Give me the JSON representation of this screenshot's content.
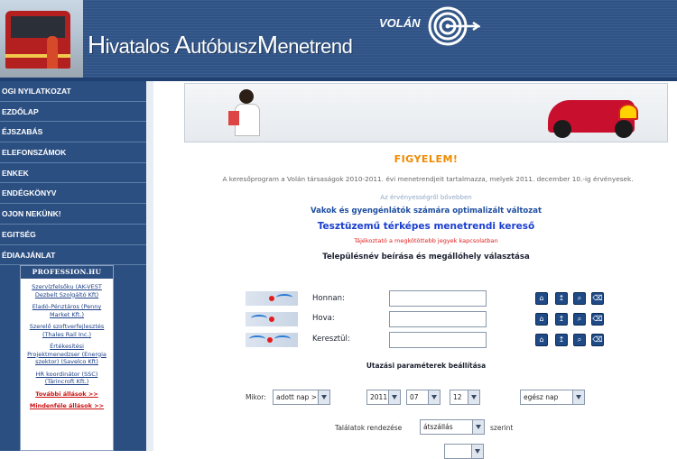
{
  "header": {
    "title_parts": [
      {
        "cap": "H",
        "rest": "ivatalos "
      },
      {
        "cap": "A",
        "rest": "utóbusz"
      },
      {
        "cap": "M",
        "rest": "enetrend"
      }
    ],
    "logo_text": "VOLÁN"
  },
  "sidebar": {
    "items": [
      {
        "label": "OGI NYILATKOZAT"
      },
      {
        "label": "EZDŐLAP"
      },
      {
        "label": "ÉJSZABÁS"
      },
      {
        "label": "ELEFONSZÁMOK"
      },
      {
        "label": "ENKEK"
      },
      {
        "label": "ENDÉGKÖNYV"
      },
      {
        "label": "OJON NEKÜNK!"
      },
      {
        "label": "EGITSÉG"
      },
      {
        "label": "ÉDIAAJÁNLAT"
      }
    ],
    "partner_box": {
      "header": "PROFESSION.HU",
      "entries": [
        {
          "text": "Szervízfelsőku (AK-VEST Dezbelt Szolgáltó Kft)"
        },
        {
          "text": "Eladó-Pénztáros (Penny Market Kft.)"
        },
        {
          "text": "Szerelő szoftverfejlesztés (Thales Rail Inc.)"
        },
        {
          "text": "Értékesítési Projektmenedzser (Energia szektor) (Savelco Kft)"
        },
        {
          "text": "HR koordinátor (SSC) (Tárincroft Kft.)"
        },
        {
          "text": "További állások >>",
          "red": true
        },
        {
          "text": "Mindenféle állások >>",
          "red": true
        }
      ]
    }
  },
  "main": {
    "warning_title": "FIGYELEM!",
    "warning_text": "A keresőprogram a Volán társaságok 2010-2011. évi menetrendjeit tartalmazza, melyek 2011. december 10.-ig érvényesek.",
    "validity_more": "Az érvényességről bővebben",
    "blind_link": "Vakok és gyengénlátók számára optimalizált változat",
    "map_link": "Tesztüzemű térképes menetrendi kereső",
    "ticket_link": "Tájékoztató a megkötöttebb jegyek kapcsolatban",
    "city_title": "Településnév beírása és megállóhely választása",
    "fields": [
      {
        "label": "Honnan:",
        "value": ""
      },
      {
        "label": "Hova:",
        "value": ""
      },
      {
        "label": "Keresztül:",
        "value": ""
      }
    ],
    "params_title": "Utazási paraméterek beállítása",
    "when_label": "Mikor:",
    "date_mode": "adott nap >>",
    "year": "2011",
    "month": "07",
    "day": "12",
    "day_option": "egész nap",
    "sort_label": "Találatok rendezése",
    "sort_value": "átszállás",
    "sort_after": "szerint"
  }
}
